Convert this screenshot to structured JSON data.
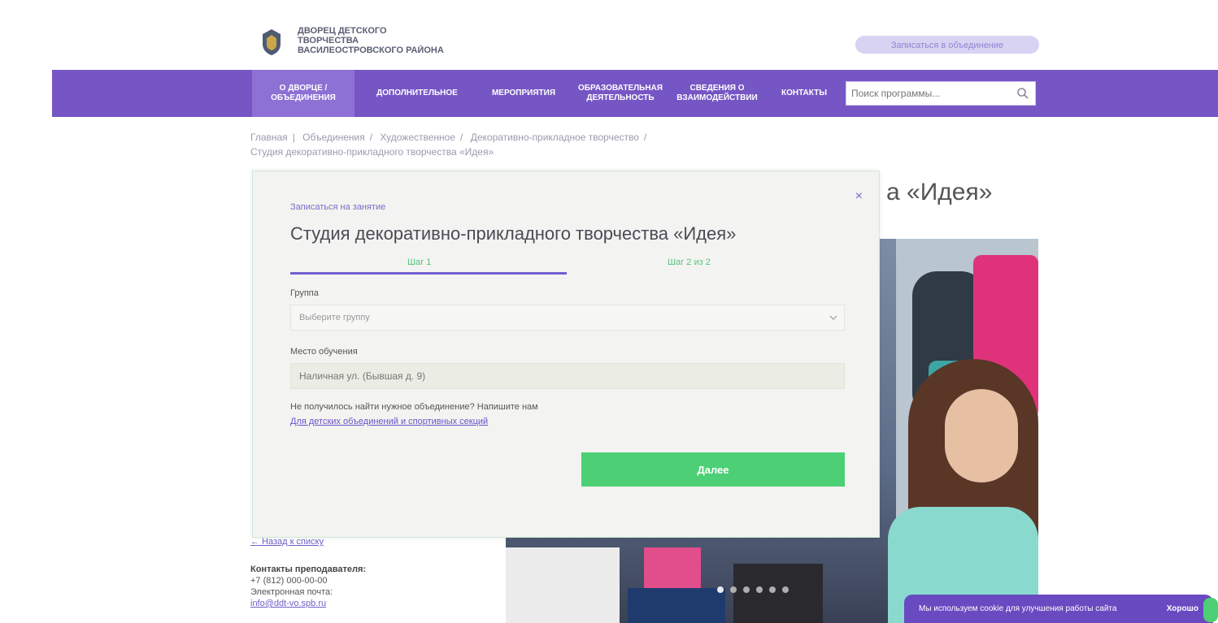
{
  "header": {
    "logo_lines": [
      "ДВОРЕЦ ДЕТСКОГО",
      "ТВОРЧЕСТВА",
      "ВАСИЛЕОСТРОВСКОГО РАЙОНА"
    ],
    "right_pill": "Записаться в объединение"
  },
  "nav": {
    "items": [
      {
        "label": "О ДВОРЦЕ / ОБЪЕДИНЕНИЯ"
      },
      {
        "label": "ДОПОЛНИТЕЛЬНОЕ"
      },
      {
        "label": "МЕРОПРИЯТИЯ"
      },
      {
        "label": "ОБРАЗОВАТЕЛЬНАЯ ДЕЯТЕЛЬНОСТЬ"
      },
      {
        "label": "СВЕДЕНИЯ О ВЗАИМОДЕЙСТВИИ"
      },
      {
        "label": "КОНТАКТЫ"
      }
    ],
    "search_placeholder": "Поиск программы..."
  },
  "breadcrumb": {
    "line1": [
      "Главная",
      "Объединения",
      "Художественное",
      "Декоративно-прикладное творчество"
    ],
    "line2": "Студия декоративно-прикладного творчества «Идея»"
  },
  "page": {
    "title_fragment": "а «Идея»"
  },
  "modal": {
    "kicker": "Записаться на занятие",
    "title": "Студия декоративно-прикладного творчества «Идея»",
    "progress_pct": 100,
    "step1": "Шаг 1",
    "step2": "Шаг 2 из 2",
    "group_label": "Группа",
    "group_value": "Выберите группу",
    "place_label": "Место обучения",
    "place_value": "Наличная ул. (Бывшая д. 9)",
    "note": "Не получилось найти нужное объединение? Напишите нам",
    "link": "Для детских объединений и спортивных секций",
    "submit": "Далее",
    "close": "×"
  },
  "left_info": {
    "link": "← Назад к списку",
    "contacts_label": "Контакты преподавателя:",
    "phone": "+7 (812) 000-00-00",
    "email_label": "Электронная почта:",
    "email": "info@ddt-vo.spb.ru"
  },
  "banner": {
    "text": "Мы используем cookie для улучшения работы сайта",
    "ok": "Хорошо"
  },
  "colors": {
    "nav": "#7656c4",
    "accent_green": "#4ccf75",
    "banner": "#6a4ac0"
  }
}
